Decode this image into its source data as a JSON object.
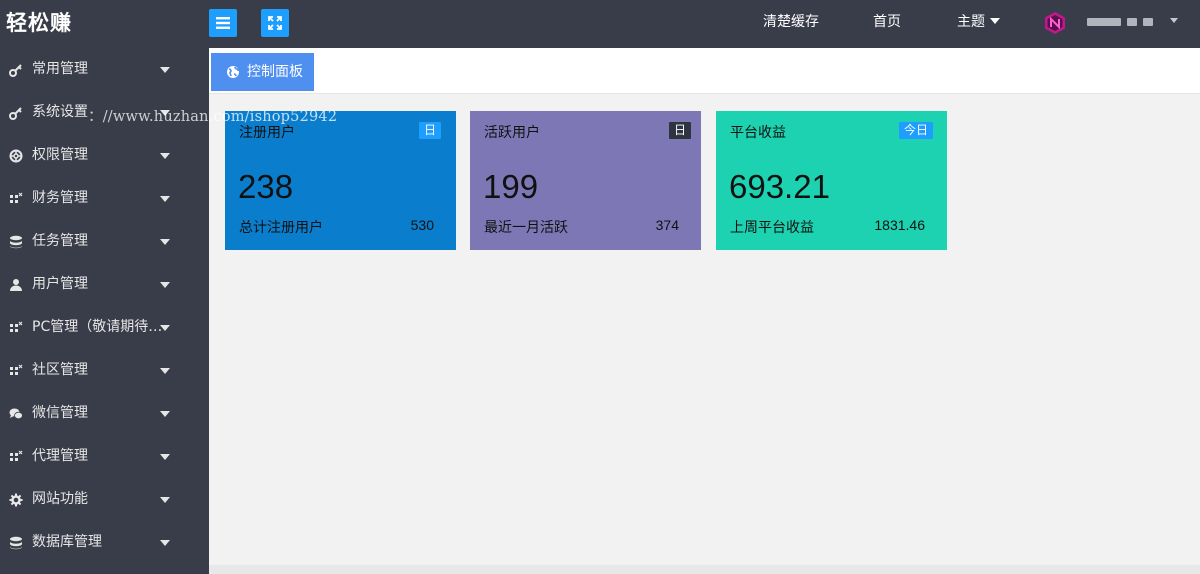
{
  "app": {
    "logo": "轻松赚"
  },
  "header": {
    "links": [
      {
        "label": "清楚缓存"
      },
      {
        "label": "首页"
      },
      {
        "label": "主题"
      }
    ]
  },
  "sidebar": {
    "items": [
      {
        "label": "常用管理",
        "icon": "key-icon"
      },
      {
        "label": "系统设置",
        "icon": "key-icon"
      },
      {
        "label": "权限管理",
        "icon": "lifebuoy-icon"
      },
      {
        "label": "财务管理",
        "icon": "grid-icon"
      },
      {
        "label": "任务管理",
        "icon": "database-icon"
      },
      {
        "label": "用户管理",
        "icon": "user-icon"
      },
      {
        "label": "PC管理（敬请期待…",
        "icon": "grid-icon"
      },
      {
        "label": "社区管理",
        "icon": "grid-icon"
      },
      {
        "label": "微信管理",
        "icon": "chat-icon"
      },
      {
        "label": "代理管理",
        "icon": "grid-icon"
      },
      {
        "label": "网站功能",
        "icon": "gear-icon"
      },
      {
        "label": "数据库管理",
        "icon": "database-icon"
      }
    ]
  },
  "watermark": "：//www.huzhan.com/ishop52942",
  "tab": {
    "label": "控制面板"
  },
  "cards": [
    {
      "title": "注册用户",
      "badge": "日",
      "value": "238",
      "sub_label": "总计注册用户",
      "sub_value": "530",
      "bg": "#0a7ecd",
      "badge_bg": "#1e9fff"
    },
    {
      "title": "活跃用户",
      "badge": "日",
      "value": "199",
      "sub_label": "最近一月活跃",
      "sub_value": "374",
      "bg": "#7d78b5",
      "badge_bg": "#2f3540"
    },
    {
      "title": "平台收益",
      "badge": "今日",
      "value": "693.21",
      "sub_label": "上周平台收益",
      "sub_value": "1831.46",
      "bg": "#1dd2b1",
      "badge_bg": "#1e9fff"
    }
  ],
  "colors": {
    "sidebar": "#393d49",
    "accent": "#1e9fff",
    "tab": "#4e8ff0"
  }
}
